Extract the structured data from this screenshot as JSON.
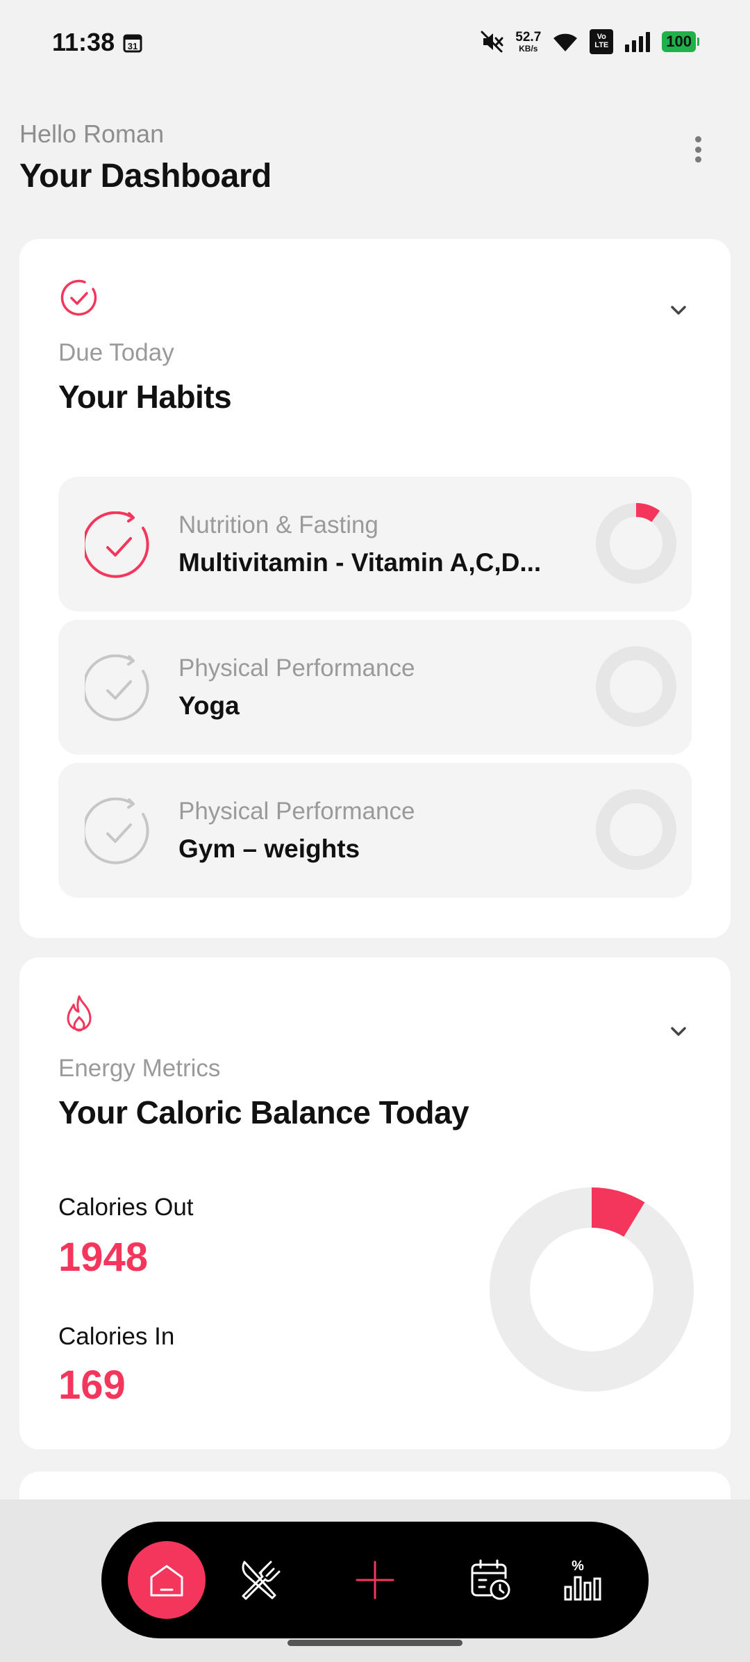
{
  "status_bar": {
    "time": "11:38",
    "calendar_day": "31",
    "net_speed_value": "52.7",
    "net_speed_unit": "KB/s",
    "volte_top": "Vo",
    "volte_bottom": "LTE",
    "battery": "100",
    "icons": [
      "calendar-icon",
      "mute-icon",
      "wifi-icon",
      "volte-icon",
      "signal-icon",
      "battery-icon"
    ]
  },
  "header": {
    "greeting": "Hello Roman",
    "title": "Your Dashboard"
  },
  "habits_card": {
    "eyebrow": "Due Today",
    "title": "Your Habits",
    "items": [
      {
        "category": "Nutrition & Fasting",
        "name": "Multivitamin - Vitamin A,C,D...",
        "active": true,
        "progress": 0.1
      },
      {
        "category": "Physical Performance",
        "name": "Yoga",
        "active": false,
        "progress": 0
      },
      {
        "category": "Physical Performance",
        "name": "Gym – weights",
        "active": false,
        "progress": 0
      }
    ]
  },
  "energy_card": {
    "eyebrow": "Energy Metrics",
    "title": "Your Caloric Balance Today",
    "calories_out_label": "Calories Out",
    "calories_out_value": "1948",
    "calories_in_label": "Calories In",
    "calories_in_value": "169",
    "calories_in_fraction": 0.087
  },
  "bottom_nav": {
    "items": [
      "home-icon",
      "fork-knife-icon",
      "plus-icon",
      "calendar-clock-icon",
      "stats-icon"
    ],
    "stats_icon_symbol": "%"
  },
  "colors": {
    "accent": "#f5365c",
    "background": "#f2f2f2",
    "card": "#ffffff",
    "ring_track": "#e6e6e6"
  }
}
